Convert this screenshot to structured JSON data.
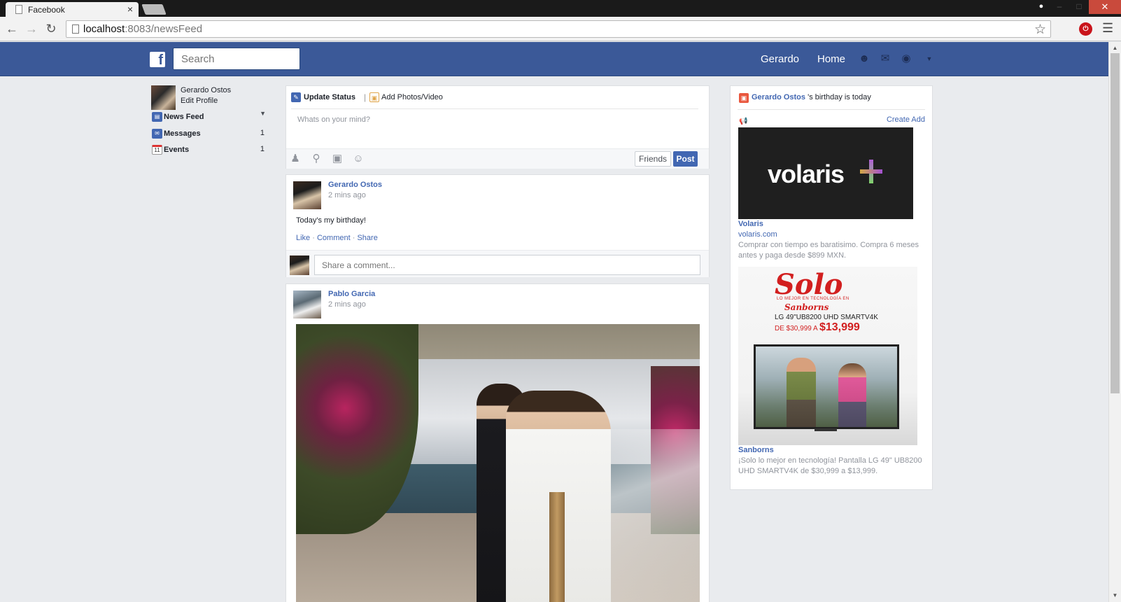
{
  "browser": {
    "tab_title": "Facebook",
    "tab_close": "×",
    "url_host": "localhost",
    "url_rest": ":8083/newsFeed"
  },
  "header": {
    "search_placeholder": "Search",
    "user_name": "Gerardo",
    "home_label": "Home"
  },
  "sidebar": {
    "profile_name": "Gerardo Ostos",
    "edit_profile": "Edit Profile",
    "items": [
      {
        "label": "News Feed",
        "count": ""
      },
      {
        "label": "Messages",
        "count": "1"
      },
      {
        "label": "Events",
        "count": "1",
        "icon_text": "11"
      }
    ]
  },
  "composer": {
    "update_status": "Update Status",
    "separator": "|",
    "add_photos": "Add Photos/Video",
    "placeholder": "Whats on your mind?",
    "audience": "Friends",
    "post": "Post"
  },
  "posts": [
    {
      "author": "Gerardo Ostos",
      "time": "2 mins ago",
      "text": "Today's my birthday!",
      "like": "Like",
      "comment": "Comment",
      "share": "Share",
      "comment_placeholder": "Share a comment..."
    },
    {
      "author": "Pablo Garcia",
      "time": "2 mins ago"
    }
  ],
  "right": {
    "birthday_name": "Gerardo Ostos",
    "birthday_suffix": " 's birthday is today",
    "create_ad": "Create Add",
    "ads": [
      {
        "brand_text": "volaris",
        "title": "Volaris",
        "url": "volaris.com",
        "description": "Comprar con tiempo es baratisimo. Compra 6 meses antes y paga desde $899 MXN."
      },
      {
        "banner_logo": "Solo",
        "banner_tagline": "LO MEJOR EN TECNOLOGÍA EN",
        "banner_store": "Sanborns",
        "banner_model": "LG 49\"UB8200 UHD SMARTV4K",
        "banner_old_price": "DE $30,999 A ",
        "banner_new_price": "$13,999",
        "title": "Sanborns",
        "description": "¡Solo lo mejor en tecnología! Pantalla LG 49\" UB8200 UHD SMARTV4K de $30,999 a $13,999."
      }
    ]
  },
  "colors": {
    "fb_blue": "#3b5998",
    "link_blue": "#4267b2",
    "page_bg": "#e9ebee",
    "ad_red": "#d21f1f"
  },
  "icons": {
    "back": "back-arrow-icon",
    "forward": "forward-arrow-icon",
    "reload": "reload-icon",
    "star": "bookmark-star-icon",
    "friends": "friend-requests-icon",
    "messages": "messages-icon",
    "notifications": "globe-notifications-icon"
  }
}
